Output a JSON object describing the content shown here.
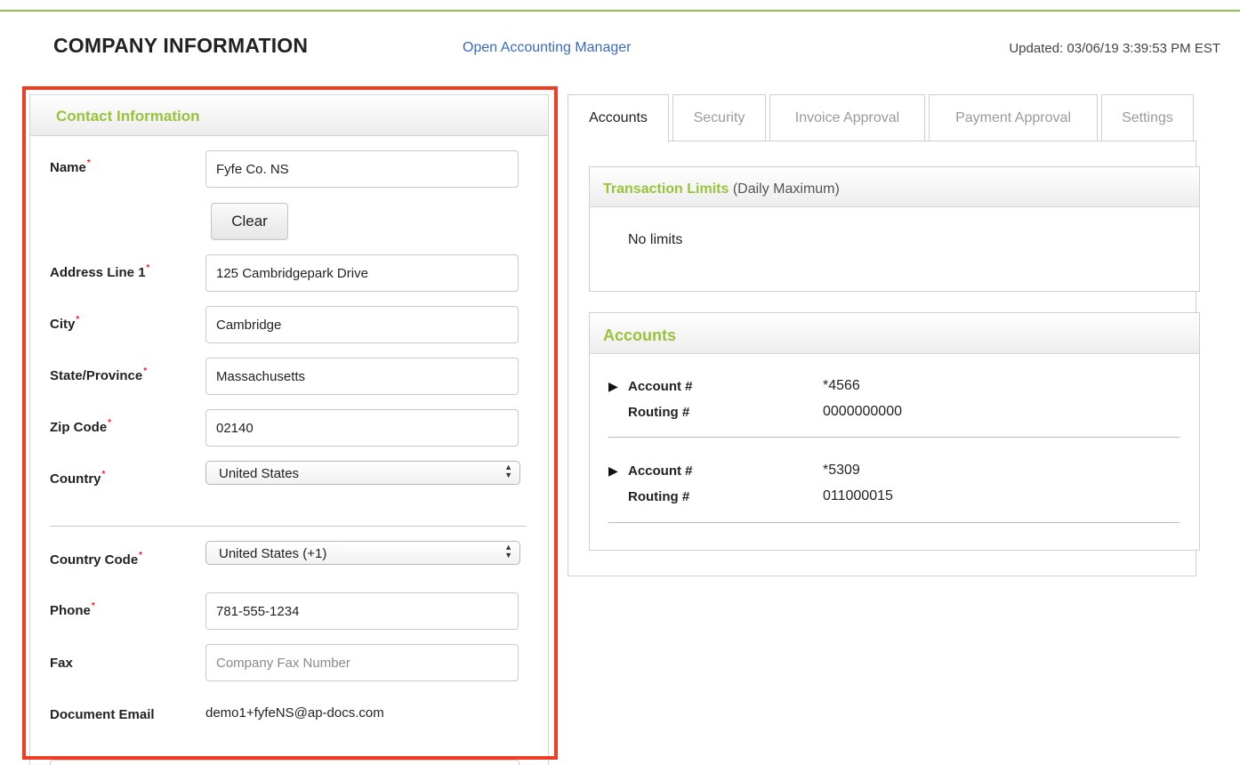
{
  "header": {
    "title": "COMPANY INFORMATION",
    "accounting_link": "Open Accounting Manager",
    "updated": "Updated: 03/06/19 3:39:53 PM EST"
  },
  "contact": {
    "panel_title": "Contact Information",
    "required_mark": "*",
    "name_label": "Name",
    "name_value": "Fyfe Co. NS",
    "clear_label": "Clear",
    "address_label": "Address Line 1",
    "address_value": "125 Cambridgepark Drive",
    "city_label": "City",
    "city_value": "Cambridge",
    "state_label": "State/Province",
    "state_value": "Massachusetts",
    "zip_label": "Zip Code",
    "zip_value": "02140",
    "country_label": "Country",
    "country_value": "United States",
    "country_code_label": "Country Code",
    "country_code_value": "United States (+1)",
    "phone_label": "Phone",
    "phone_value": "781-555-1234",
    "fax_label": "Fax",
    "fax_placeholder": "Company Fax Number",
    "email_label": "Document Email",
    "email_value": "demo1+fyfeNS@ap-docs.com"
  },
  "tabs": [
    {
      "label": "Accounts",
      "active": true
    },
    {
      "label": "Security",
      "active": false
    },
    {
      "label": "Invoice Approval",
      "active": false
    },
    {
      "label": "Payment Approval",
      "active": false
    },
    {
      "label": "Settings",
      "active": false
    }
  ],
  "limits": {
    "title": "Transaction Limits",
    "subtitle": "(Daily Maximum)",
    "text": "No limits"
  },
  "accounts": {
    "title": "Accounts",
    "expand_glyph": "▶",
    "account_label": "Account #",
    "routing_label": "Routing #",
    "items": [
      {
        "account": "*4566",
        "routing": "0000000000"
      },
      {
        "account": "*5309",
        "routing": "011000015"
      }
    ]
  },
  "colors": {
    "accent_green": "#9ac23c",
    "link_blue": "#3b6bb5",
    "highlight_red": "#f03c21",
    "required_red": "#ee2222"
  }
}
